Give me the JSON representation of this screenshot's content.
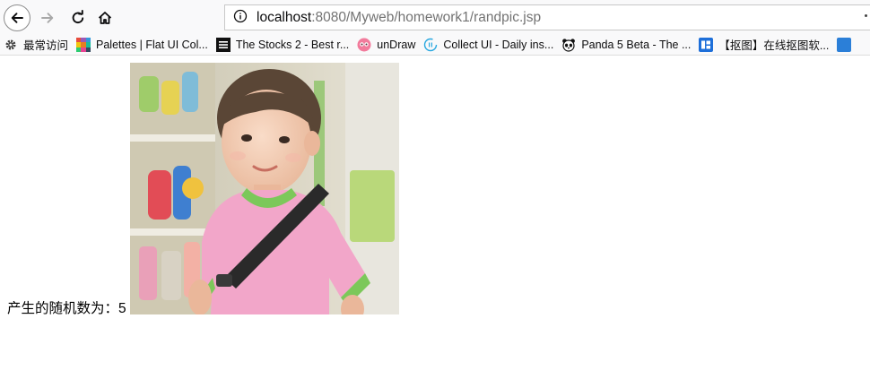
{
  "browser": {
    "url_host": "localhost",
    "url_rest": ":8080/Myweb/homework1/randpic.jsp"
  },
  "bookmarks": [
    {
      "label": "最常访问",
      "icon": "gear-icon"
    },
    {
      "label": "Palettes | Flat UI Col...",
      "icon": "palette-icon"
    },
    {
      "label": "The Stocks 2 - Best r...",
      "icon": "stocks-icon"
    },
    {
      "label": "unDraw",
      "icon": "undraw-icon"
    },
    {
      "label": "Collect UI - Daily ins...",
      "icon": "collectui-icon"
    },
    {
      "label": "Panda 5 Beta - The ...",
      "icon": "panda-icon"
    },
    {
      "label": "【抠图】在线抠图软...",
      "icon": "koutu-icon"
    }
  ],
  "page": {
    "label": "产生的随机数为：5"
  },
  "colors": {
    "toolbar_bg": "#f9f9fa",
    "shirt": "#f2a6c9",
    "collar": "#7cc85a"
  }
}
